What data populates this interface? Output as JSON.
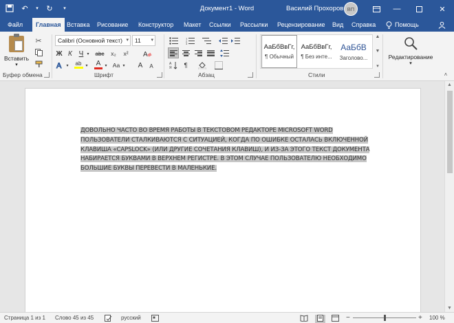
{
  "window": {
    "title": "Документ1 - Word",
    "user": "Василий Прохоров",
    "avatar_initials": "ВП",
    "accent_color": "#2b579a"
  },
  "tabs": [
    {
      "label": "Файл"
    },
    {
      "label": "Главная",
      "active": true
    },
    {
      "label": "Вставка"
    },
    {
      "label": "Рисование"
    },
    {
      "label": "Конструктор"
    },
    {
      "label": "Макет"
    },
    {
      "label": "Ссылки"
    },
    {
      "label": "Рассылки"
    },
    {
      "label": "Рецензирование"
    },
    {
      "label": "Вид"
    },
    {
      "label": "Справка"
    }
  ],
  "tell_me": "Помощь",
  "ribbon": {
    "clipboard": {
      "paste_label": "Вставить",
      "group_label": "Буфер обмена"
    },
    "font": {
      "font_name": "Calibri (Основной текст)",
      "font_size": "11",
      "group_label": "Шрифт",
      "grow_label": "A",
      "shrink_label": "A",
      "case_label": "Aa",
      "bold": "Ж",
      "italic": "К",
      "underline": "Ч",
      "strike": "abc",
      "subscript": "x₂",
      "superscript": "x²",
      "font_color_label": "A",
      "highlight_label": "ab"
    },
    "paragraph": {
      "group_label": "Абзац"
    },
    "styles": {
      "group_label": "Стили",
      "items": [
        {
          "sample": "АаБбВвГг,",
          "name": "¶ Обычный"
        },
        {
          "sample": "АаБбВвГг,",
          "name": "¶ Без инте..."
        },
        {
          "sample": "АаБбВ",
          "name": "Заголово..."
        }
      ]
    },
    "editing": {
      "label": "Редактирование"
    }
  },
  "document": {
    "text": "ДОВОЛЬНО ЧАСТО ВО ВРЕМЯ РАБОТЫ В ТЕКСТОВОМ РЕДАКТОРЕ MICROSOFT WORD ПОЛЬЗОВАТЕЛИ СТАЛКИВАЮТСЯ С СИТУАЦИЕЙ, КОГДА ПО ОШИБКЕ ОСТАЛАСЬ ВКЛЮЧЕННОЙ КЛАВИША «CAPSLOCK» (ИЛИ ДРУГИЕ СОЧЕТАНИЯ КЛАВИШ), И ИЗ-ЗА ЭТОГО ТЕКСТ ДОКУМЕНТА НАБИРАЕТСЯ БУКВАМИ В ВЕРХНЕМ РЕГИСТРЕ. В ЭТОМ СЛУЧАЕ ПОЛЬЗОВАТЕЛЮ НЕОБХОДИМО БОЛЬШИЕ БУКВЫ ПЕРЕВЕСТИ В МАЛЕНЬКИЕ."
  },
  "status": {
    "page": "Страница 1 из 1",
    "words": "Слово 45 из 45",
    "language": "русский",
    "zoom": "100 %",
    "zoom_minus": "−",
    "zoom_plus": "+"
  }
}
